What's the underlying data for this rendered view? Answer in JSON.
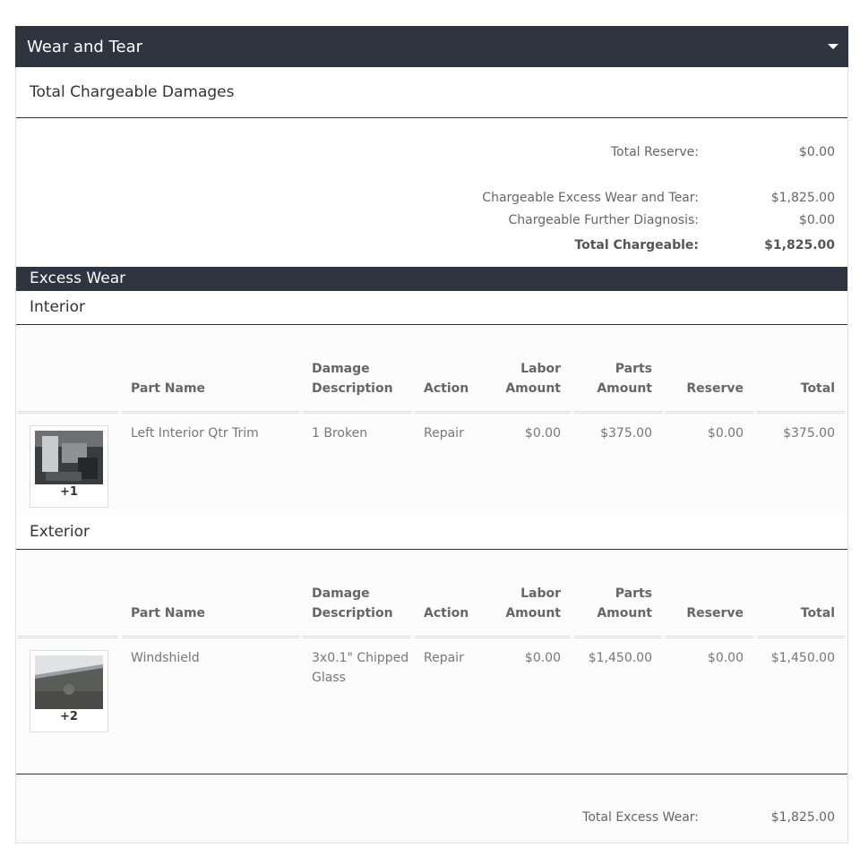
{
  "panel": {
    "title": "Wear and Tear"
  },
  "total_chargeable": {
    "title": "Total Chargeable Damages",
    "rows": [
      {
        "label": "Total Reserve:",
        "value": "$0.00"
      },
      {
        "label": "Chargeable Excess Wear and Tear:",
        "value": "$1,825.00"
      },
      {
        "label": "Chargeable Further Diagnosis:",
        "value": "$0.00"
      },
      {
        "label": "Total Chargeable:",
        "value": "$1,825.00"
      }
    ]
  },
  "excess_wear": {
    "title": "Excess Wear",
    "columns": {
      "part_name": "Part Name",
      "damage_1": "Damage",
      "damage_2": "Description",
      "action": "Action",
      "labor_1": "Labor",
      "labor_2": "Amount",
      "parts_1": "Parts",
      "parts_2": "Amount",
      "reserve": "Reserve",
      "total": "Total"
    },
    "interior": {
      "title": "Interior",
      "rows": [
        {
          "photo_count": "+1",
          "part_name": "Left Interior Qtr Trim",
          "damage": "1 Broken",
          "action": "Repair",
          "labor": "$0.00",
          "parts": "$375.00",
          "reserve": "$0.00",
          "total": "$375.00"
        }
      ]
    },
    "exterior": {
      "title": "Exterior",
      "rows": [
        {
          "photo_count": "+2",
          "part_name": "Windshield",
          "damage_1": "3x0.1\" Chipped",
          "damage_2": "Glass",
          "action": "Repair",
          "labor": "$0.00",
          "parts": "$1,450.00",
          "reserve": "$0.00",
          "total": "$1,450.00"
        }
      ]
    },
    "footer": {
      "label": "Total Excess Wear:",
      "value": "$1,825.00"
    }
  },
  "colors": {
    "header_bg": "#2e3440",
    "rule": "#333333"
  }
}
